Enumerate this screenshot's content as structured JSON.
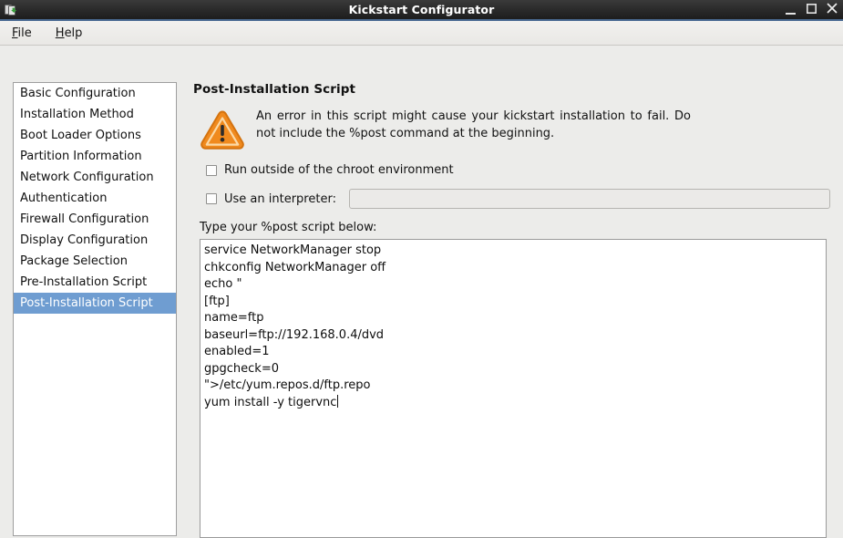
{
  "window": {
    "title": "Kickstart Configurator",
    "icon": "app-icon",
    "controls": {
      "minimize": "_",
      "maximize": "☐",
      "close": "✕"
    }
  },
  "menubar": {
    "items": [
      {
        "label": "File",
        "mnemonic": "F",
        "rest": "ile"
      },
      {
        "label": "Help",
        "mnemonic": "H",
        "rest": "elp"
      }
    ]
  },
  "sidebar": {
    "items": [
      {
        "label": "Basic Configuration",
        "selected": false
      },
      {
        "label": "Installation Method",
        "selected": false
      },
      {
        "label": "Boot Loader Options",
        "selected": false
      },
      {
        "label": "Partition Information",
        "selected": false
      },
      {
        "label": "Network Configuration",
        "selected": false
      },
      {
        "label": "Authentication",
        "selected": false
      },
      {
        "label": "Firewall Configuration",
        "selected": false
      },
      {
        "label": "Display Configuration",
        "selected": false
      },
      {
        "label": "Package Selection",
        "selected": false
      },
      {
        "label": "Pre-Installation Script",
        "selected": false
      },
      {
        "label": "Post-Installation Script",
        "selected": true
      }
    ],
    "selected_index": 10,
    "selection_color": "#6f9dd1"
  },
  "pane": {
    "title": "Post-Installation Script",
    "warning": {
      "icon": "warning-triangle-icon",
      "color": "#f0891f",
      "text": "An error in this script might cause your kickstart installation to fail. Do not include the %post command at the beginning."
    },
    "chroot_checkbox": {
      "label": "Run outside of the chroot environment",
      "checked": false
    },
    "interpreter_checkbox": {
      "label": "Use an interpreter:",
      "checked": false
    },
    "interpreter_input": {
      "value": "",
      "placeholder": "",
      "enabled": false
    },
    "script_label": "Type your %post script below:",
    "script_lines": [
      "service NetworkManager stop",
      "chkconfig NetworkManager off",
      "echo \"",
      "[ftp]",
      "name=ftp",
      "baseurl=ftp://192.168.0.4/dvd",
      "enabled=1",
      "gpgcheck=0",
      "\">/etc/yum.repos.d/ftp.repo",
      "yum install -y tigervnc"
    ],
    "caret_after_line": 9
  }
}
